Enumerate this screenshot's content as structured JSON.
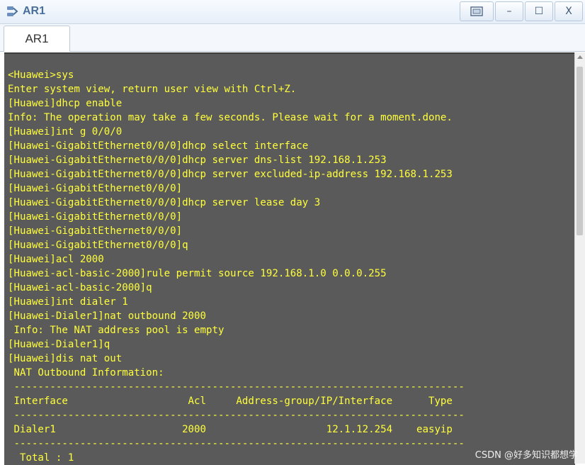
{
  "window": {
    "title": "AR1",
    "icon": "router-console-icon",
    "controls": {
      "restore_icon": "restore-window-icon",
      "minimize": "–",
      "maximize": "☐",
      "close": "X"
    }
  },
  "tabs": [
    {
      "label": "AR1",
      "active": true
    }
  ],
  "terminal": {
    "text_color": "#ffff3c",
    "background": "#5a5a5a",
    "lines": [
      "<Huawei>sys",
      "Enter system view, return user view with Ctrl+Z.",
      "[Huawei]dhcp enable",
      "Info: The operation may take a few seconds. Please wait for a moment.done.",
      "[Huawei]int g 0/0/0",
      "[Huawei-GigabitEthernet0/0/0]dhcp select interface",
      "[Huawei-GigabitEthernet0/0/0]dhcp server dns-list 192.168.1.253",
      "[Huawei-GigabitEthernet0/0/0]dhcp server excluded-ip-address 192.168.1.253",
      "[Huawei-GigabitEthernet0/0/0]",
      "[Huawei-GigabitEthernet0/0/0]dhcp server lease day 3",
      "[Huawei-GigabitEthernet0/0/0]",
      "[Huawei-GigabitEthernet0/0/0]",
      "[Huawei-GigabitEthernet0/0/0]q",
      "[Huawei]acl 2000",
      "[Huawei-acl-basic-2000]rule permit source 192.168.1.0 0.0.0.255",
      "[Huawei-acl-basic-2000]q",
      "[Huawei]int dialer 1",
      "[Huawei-Dialer1]nat outbound 2000",
      " Info: The NAT address pool is empty",
      "[Huawei-Dialer1]q",
      "[Huawei]dis nat out",
      " NAT Outbound Information:",
      " ---------------------------------------------------------------------------",
      " Interface                    Acl     Address-group/IP/Interface      Type",
      " ---------------------------------------------------------------------------",
      " Dialer1                     2000                    12.1.12.254    easyip",
      " ---------------------------------------------------------------------------",
      "  Total : 1"
    ]
  },
  "watermark": "CSDN @好多知识都想学"
}
